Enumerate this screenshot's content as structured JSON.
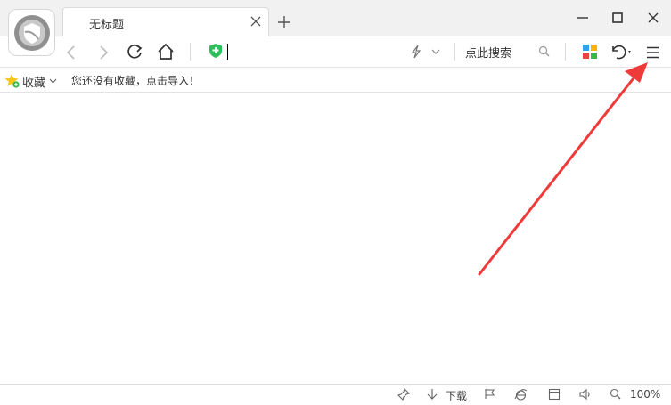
{
  "window": {
    "logo_icon": "browser-logo-icon",
    "minimize_icon": "minimize-icon",
    "maximize_icon": "maximize-icon",
    "close_icon": "window-close-icon"
  },
  "tabs": [
    {
      "title": "无标题",
      "active": true
    }
  ],
  "toolbar": {
    "address_value": "",
    "search_label": "点此搜索",
    "icons": [
      "back-icon",
      "forward-icon",
      "reload-icon",
      "home-icon",
      "shield-icon",
      "lightning-icon",
      "search-icon",
      "apps-icon",
      "undo-icon",
      "menu-icon"
    ]
  },
  "bookmarks": {
    "label": "收藏",
    "empty_message": "您还没有收藏，点击导入！"
  },
  "statusbar": {
    "download_label": "下载",
    "zoom": "100%"
  },
  "annotation": {
    "arrow_color": "#ef3a3a",
    "target": "menu-icon"
  }
}
